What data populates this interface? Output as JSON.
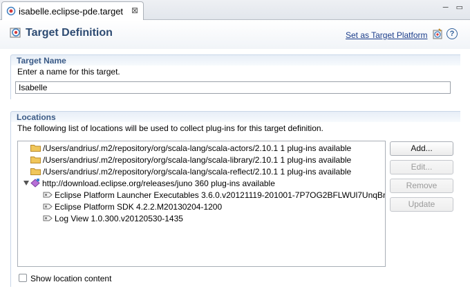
{
  "editor_tab": {
    "label": "isabelle.eclipse-pde.target",
    "close_glyph": "⊠"
  },
  "window_controls": {
    "minimize": "─",
    "maximize": "▭"
  },
  "header": {
    "title": "Target Definition",
    "link": "Set as Target Platform",
    "help_glyph": "?"
  },
  "target_name": {
    "title": "Target Name",
    "description": "Enter a name for this target.",
    "value": "Isabelle"
  },
  "locations": {
    "title": "Locations",
    "description": "The following list of locations will be used to collect plug-ins for this target definition.",
    "tree": [
      {
        "text": "/Users/andrius/.m2/repository/org/scala-lang/scala-actors/2.10.1 1 plug-ins available",
        "icon": "folder-icon"
      },
      {
        "text": "/Users/andrius/.m2/repository/org/scala-lang/scala-library/2.10.1 1 plug-ins available",
        "icon": "folder-icon"
      },
      {
        "text": "/Users/andrius/.m2/repository/org/scala-lang/scala-reflect/2.10.1 1 plug-ins available",
        "icon": "folder-icon"
      },
      {
        "text": "http://download.eclipse.org/releases/juno 360 plug-ins available",
        "icon": "update-site-icon",
        "expanded": true
      },
      {
        "text": "Eclipse Platform Launcher Executables 3.6.0.v20121119-201001-7P7OG2BFLWUl7UnqBn",
        "icon": "feature-icon"
      },
      {
        "text": "Eclipse Platform SDK 4.2.2.M20130204-1200",
        "icon": "feature-icon"
      },
      {
        "text": "Log View 1.0.300.v20120530-1435",
        "icon": "feature-icon"
      }
    ],
    "buttons": {
      "add": "Add...",
      "edit": "Edit...",
      "remove": "Remove",
      "update": "Update"
    },
    "show_content_label": "Show location content",
    "show_content_checked": false
  },
  "colors": {
    "section_title": "#3a5a86",
    "header_title": "#2d4b72",
    "link": "#1a3c8a"
  }
}
